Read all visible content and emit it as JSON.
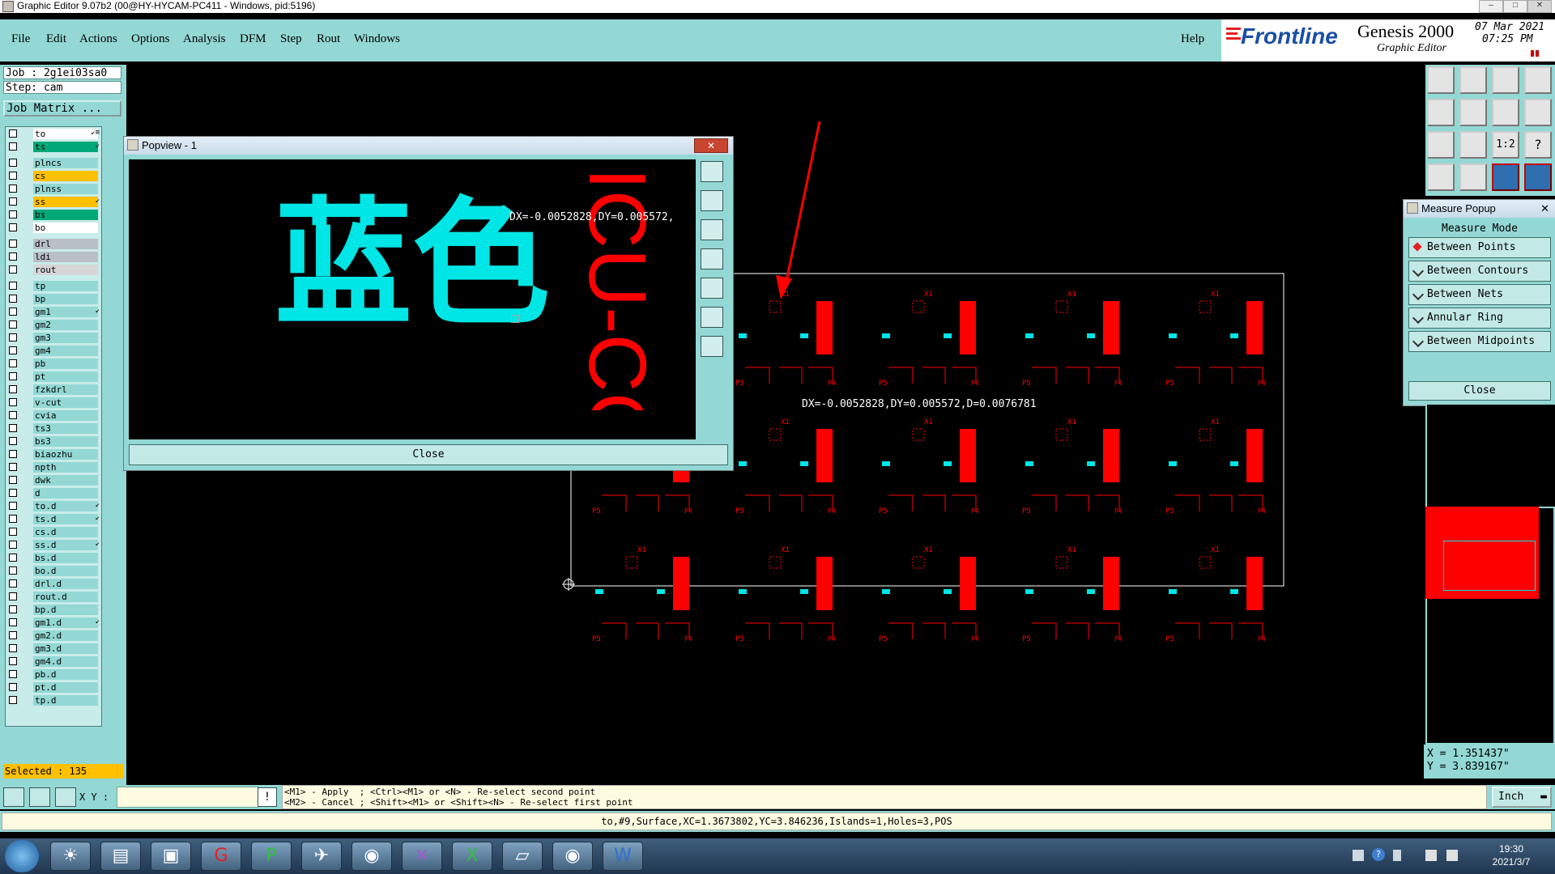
{
  "window": {
    "title": "Graphic Editor 9.07b2 (00@HY-HYCAM-PC411 - Windows, pid:5196)",
    "min": "–",
    "max": "□",
    "close": "✕"
  },
  "menu": [
    "File",
    "Edit",
    "Actions",
    "Options",
    "Analysis",
    "DFM",
    "Step",
    "Rout",
    "Windows"
  ],
  "help": "Help",
  "brand": {
    "logo": "Frontline",
    "product": "Genesis 2000",
    "subtitle": "Graphic Editor",
    "date": "07 Mar 2021",
    "time": "07:25 PM"
  },
  "job": {
    "job_label": "Job : 2g1ei03sa0",
    "step_label": "Step: cam",
    "matrix_button": "Job Matrix ..."
  },
  "layers": [
    {
      "name": "to",
      "color": "#ffffff",
      "mark": "↙≡"
    },
    {
      "name": "ts",
      "color": "#00a878",
      "mark": "↙"
    },
    {
      "name": "plncs",
      "color": "#93d8d4",
      "mark": ""
    },
    {
      "name": "cs",
      "color": "#ffc000",
      "mark": ""
    },
    {
      "name": "plnss",
      "color": "#93d8d4",
      "mark": ""
    },
    {
      "name": "ss",
      "color": "#ffc000",
      "mark": "↙"
    },
    {
      "name": "bs",
      "color": "#00a878",
      "mark": ""
    },
    {
      "name": "bo",
      "color": "#ffffff",
      "mark": ""
    },
    {
      "name": "drl",
      "color": "#b9bfc6",
      "mark": ""
    },
    {
      "name": "ldi",
      "color": "#b9bfc6",
      "mark": ""
    },
    {
      "name": "rout",
      "color": "#d6d6d6",
      "mark": ""
    },
    {
      "name": "tp",
      "color": "#93d8d4",
      "mark": ""
    },
    {
      "name": "bp",
      "color": "#93d8d4",
      "mark": ""
    },
    {
      "name": "gm1",
      "color": "#93d8d4",
      "mark": "↙"
    },
    {
      "name": "gm2",
      "color": "#93d8d4",
      "mark": ""
    },
    {
      "name": "gm3",
      "color": "#93d8d4",
      "mark": ""
    },
    {
      "name": "gm4",
      "color": "#93d8d4",
      "mark": ""
    },
    {
      "name": "pb",
      "color": "#93d8d4",
      "mark": ""
    },
    {
      "name": "pt",
      "color": "#93d8d4",
      "mark": ""
    },
    {
      "name": "fzkdrl",
      "color": "#93d8d4",
      "mark": ""
    },
    {
      "name": "v-cut",
      "color": "#93d8d4",
      "mark": ""
    },
    {
      "name": "cvia",
      "color": "#93d8d4",
      "mark": ""
    },
    {
      "name": "ts3",
      "color": "#93d8d4",
      "mark": ""
    },
    {
      "name": "bs3",
      "color": "#93d8d4",
      "mark": ""
    },
    {
      "name": "biaozhu",
      "color": "#93d8d4",
      "mark": ""
    },
    {
      "name": "npth",
      "color": "#93d8d4",
      "mark": ""
    },
    {
      "name": "dwk",
      "color": "#93d8d4",
      "mark": ""
    },
    {
      "name": "d",
      "color": "#93d8d4",
      "mark": ""
    },
    {
      "name": "to.d",
      "color": "#93d8d4",
      "mark": "↙"
    },
    {
      "name": "ts.d",
      "color": "#93d8d4",
      "mark": "↙"
    },
    {
      "name": "cs.d",
      "color": "#93d8d4",
      "mark": ""
    },
    {
      "name": "ss.d",
      "color": "#93d8d4",
      "mark": "↙"
    },
    {
      "name": "bs.d",
      "color": "#93d8d4",
      "mark": ""
    },
    {
      "name": "bo.d",
      "color": "#93d8d4",
      "mark": ""
    },
    {
      "name": "drl.d",
      "color": "#93d8d4",
      "mark": ""
    },
    {
      "name": "rout.d",
      "color": "#93d8d4",
      "mark": ""
    },
    {
      "name": "bp.d",
      "color": "#93d8d4",
      "mark": ""
    },
    {
      "name": "gm1.d",
      "color": "#93d8d4",
      "mark": "↙"
    },
    {
      "name": "gm2.d",
      "color": "#93d8d4",
      "mark": ""
    },
    {
      "name": "gm3.d",
      "color": "#93d8d4",
      "mark": ""
    },
    {
      "name": "gm4.d",
      "color": "#93d8d4",
      "mark": ""
    },
    {
      "name": "pb.d",
      "color": "#93d8d4",
      "mark": ""
    },
    {
      "name": "pt.d",
      "color": "#93d8d4",
      "mark": ""
    },
    {
      "name": "tp.d",
      "color": "#93d8d4",
      "mark": ""
    }
  ],
  "selected": "Selected : 135",
  "popview": {
    "title": "Popview - 1",
    "close": "Close",
    "text_cyan": "蓝色",
    "text_red": "ICU-CC",
    "measure_readout": "DX=-0.0052828,DY=0.005572,"
  },
  "canvas": {
    "measure_readout": "DX=-0.0052828,DY=0.005572,D=0.0076781",
    "pcb_labels": {
      "x1": "X1",
      "p5": "P5",
      "p4": "P4",
      "side": "ICU-CC"
    }
  },
  "measure_popup": {
    "title": "Measure Popup",
    "mode_label": "Measure Mode",
    "options": [
      "Between Points",
      "Between Contours",
      "Between Nets",
      "Annular Ring",
      "Between Midpoints"
    ],
    "close": "Close"
  },
  "coords": {
    "x": "X = 1.351437\"",
    "y": "Y = 3.839167\""
  },
  "command": {
    "xy_label": "X Y :",
    "xy_value": "",
    "hint1": "<M1> - Apply  ; <Ctrl><M1> or <N> - Re-select second point",
    "hint2": "<M2> - Cancel ; <Shift><M1> or <Shift><N> - Re-select first point",
    "units": "Inch"
  },
  "status": "to,#9,Surface,XC=1.3673802,YC=3.846236,Islands=1,Holes=3,POS",
  "taskbar": {
    "time": "19:30",
    "date": "2021/3/7",
    "apps": [
      "start",
      "explorer",
      "notepad",
      "save",
      "genesis",
      "pads",
      "browser",
      "fish",
      "xtool",
      "excel",
      "notes",
      "viewer",
      "word"
    ]
  },
  "colors": {
    "panel": "#93d8d4",
    "red": "#ff0000",
    "cyan": "#00e5e5",
    "accent": "#ffc000"
  }
}
